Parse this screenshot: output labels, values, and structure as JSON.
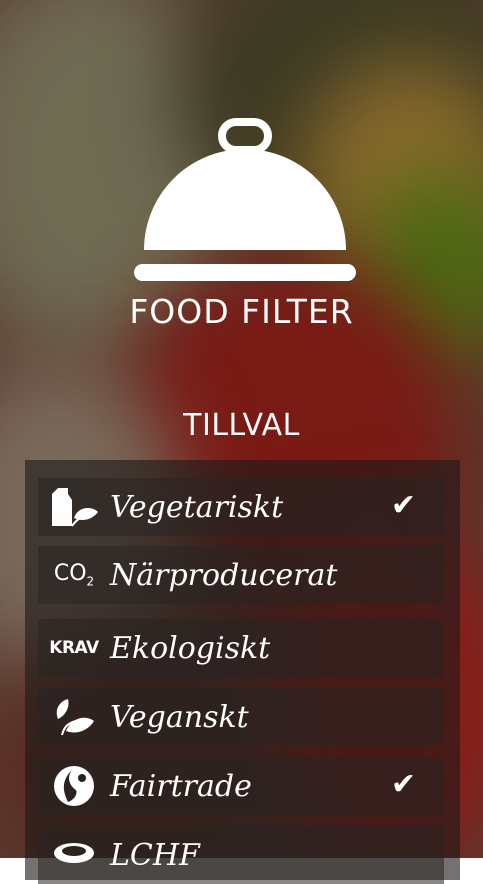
{
  "app": {
    "title": "FOOD FILTER"
  },
  "section": {
    "title": "TILLVAL"
  },
  "options": [
    {
      "label": "Vegetariskt",
      "icon": "milk-carton-leaf-icon",
      "checked": true
    },
    {
      "label": "Närproducerat",
      "icon": "co2-icon",
      "icon_text": "CO",
      "icon_sub": "2",
      "checked": false
    },
    {
      "label": "Ekologiskt",
      "icon": "krav-icon",
      "icon_text": "KRAV",
      "checked": false
    },
    {
      "label": "Veganskt",
      "icon": "leaf-icon",
      "checked": false
    },
    {
      "label": "Fairtrade",
      "icon": "fairtrade-icon",
      "checked": true
    },
    {
      "label": "LCHF",
      "icon": "bowl-icon",
      "checked": false
    }
  ],
  "check_glyph": "✔",
  "colors": {
    "text": "#ffffff",
    "panel": "#1e1a18"
  }
}
